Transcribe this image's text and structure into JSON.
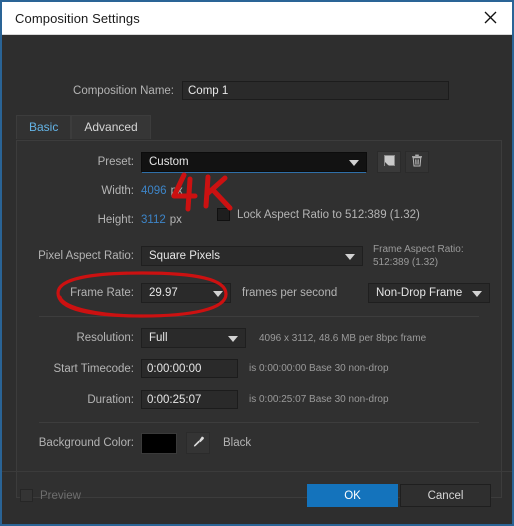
{
  "window": {
    "title": "Composition Settings",
    "close_icon": "close-icon"
  },
  "composition_name": {
    "label": "Composition Name:",
    "value": "Comp 1"
  },
  "tabs": [
    {
      "label": "Basic",
      "active": true
    },
    {
      "label": "Advanced",
      "active": false
    }
  ],
  "preset": {
    "label": "Preset:",
    "value": "Custom",
    "save_icon": "save-preset-icon",
    "delete_icon": "trash-icon"
  },
  "width": {
    "label": "Width:",
    "value": "4096",
    "unit": "px"
  },
  "height": {
    "label": "Height:",
    "value": "3112",
    "unit": "px"
  },
  "lock_aspect": {
    "label": "Lock Aspect Ratio to 512:389 (1.32)",
    "checked": false
  },
  "pixel_aspect_ratio": {
    "label": "Pixel Aspect Ratio:",
    "value": "Square Pixels"
  },
  "frame_aspect_ratio": {
    "label": "Frame Aspect Ratio:",
    "value": "512:389 (1.32)"
  },
  "frame_rate": {
    "label": "Frame Rate:",
    "value": "29.97",
    "unit_label": "frames per second",
    "drop_frame": "Non-Drop Frame"
  },
  "resolution": {
    "label": "Resolution:",
    "value": "Full",
    "info": "4096 x 3112, 48.6 MB per 8bpc frame"
  },
  "start_timecode": {
    "label": "Start Timecode:",
    "value": "0:00:00:00",
    "info": "is 0:00:00:00 Base 30  non-drop"
  },
  "duration": {
    "label": "Duration:",
    "value": "0:00:25:07",
    "info": "is 0:00:25:07 Base 30  non-drop"
  },
  "background_color": {
    "label": "Background Color:",
    "swatch": "#000000",
    "eyedropper_icon": "eyedropper-icon",
    "name": "Black"
  },
  "footer": {
    "preview_label": "Preview",
    "preview_checked": false,
    "ok_label": "OK",
    "cancel_label": "Cancel"
  },
  "annotations": {
    "color": "#cc1111",
    "text_4k": "4K",
    "ellipse_target": "frame-rate-field"
  }
}
